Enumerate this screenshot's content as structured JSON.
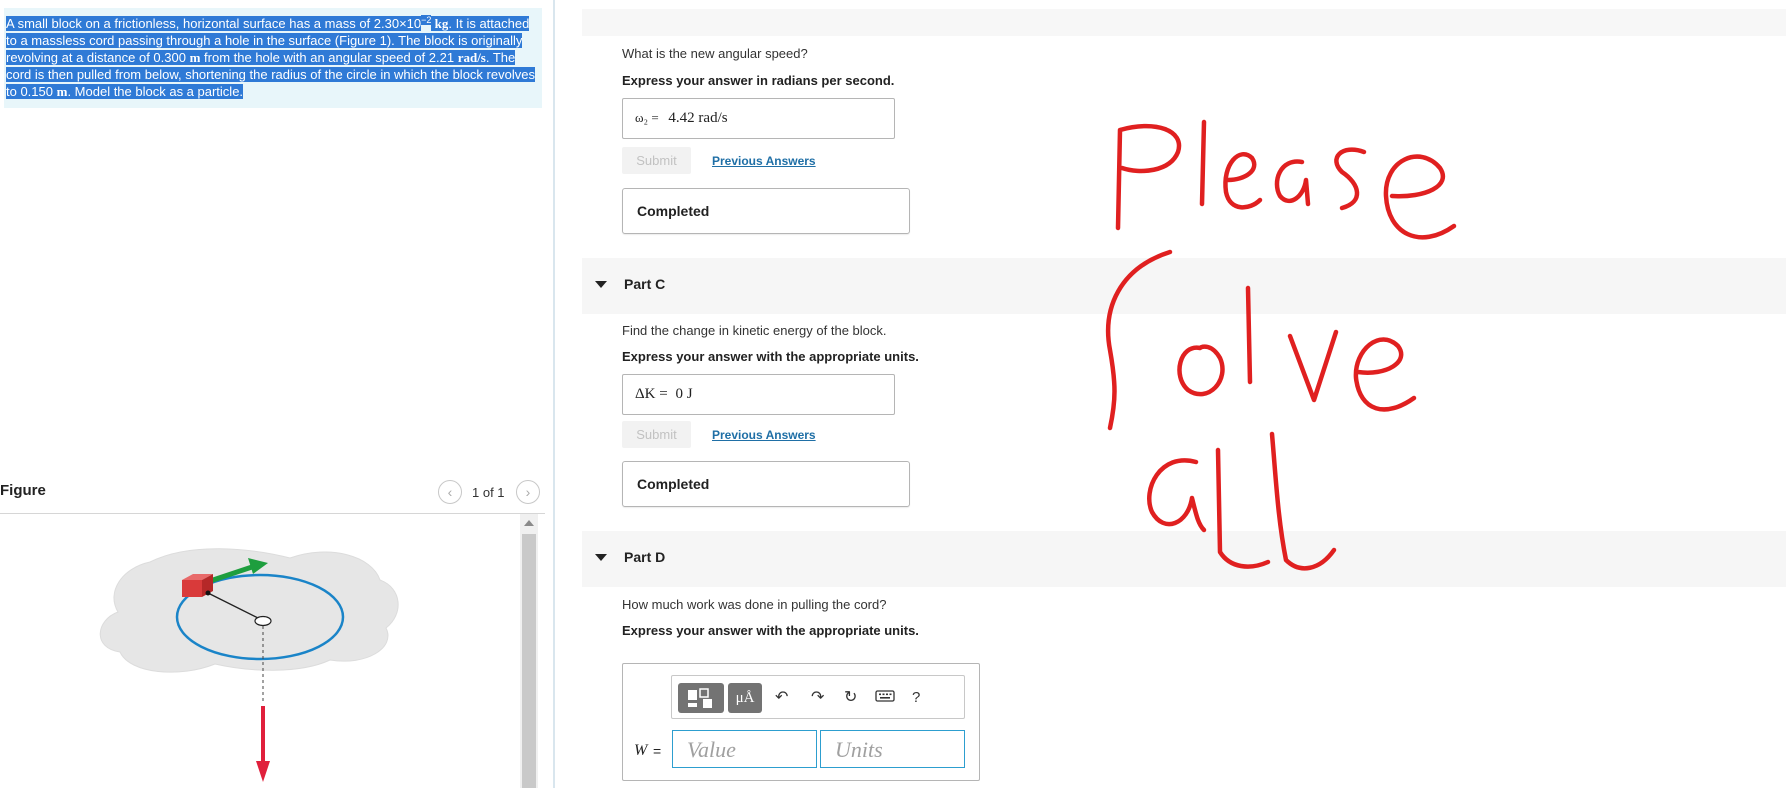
{
  "problem": {
    "segments": [
      {
        "text": "A small block on a frictionless, horizontal surface has a mass of ",
        "style": "plain"
      },
      {
        "text": "2.30×10",
        "style": "plain"
      },
      {
        "text": "−2",
        "style": "sup"
      },
      {
        "text": " kg",
        "style": "math-unit"
      },
      {
        "text": ". It is attached to a massless cord passing through a hole in the surface (Figure 1). The block is originally revolving at a distance of 0.300 ",
        "style": "plain"
      },
      {
        "text": "m",
        "style": "math-unit"
      },
      {
        "text": " from the hole with an angular speed of 2.21 ",
        "style": "plain"
      },
      {
        "text": "rad/s",
        "style": "math-unit"
      },
      {
        "text": ". The cord is then pulled from below, shortening the radius of the circle in which the block revolves to 0.150 ",
        "style": "plain"
      },
      {
        "text": "m",
        "style": "math-unit"
      },
      {
        "text": ". Model the block as a particle.",
        "style": "plain"
      }
    ]
  },
  "figure": {
    "title": "Figure",
    "counter": "1 of 1",
    "prev_icon": "chevron-left-icon",
    "next_icon": "chevron-right-icon",
    "colors": {
      "block": "#d93a3a",
      "velocity_arrow": "#1e9e3e",
      "orbit": "#1a84c8",
      "pull_arrow": "#e0203c",
      "surface": "#e8e8e8"
    }
  },
  "part_b": {
    "question": "What is the new angular speed?",
    "instruction": "Express your answer in radians per second.",
    "answer_label": "ω₂ =",
    "answer_value": "4.42  rad/s",
    "submit_label": "Submit",
    "previous_answers_label": "Previous Answers",
    "status": "Completed"
  },
  "part_c": {
    "title": "Part C",
    "question": "Find the change in kinetic energy of the block.",
    "instruction": "Express your answer with the appropriate units.",
    "answer_label": "ΔK =",
    "answer_value": "0 J",
    "submit_label": "Submit",
    "previous_answers_label": "Previous Answers",
    "status": "Completed"
  },
  "part_d": {
    "title": "Part D",
    "question": "How much work was done in pulling the cord?",
    "instruction": "Express your answer with the appropriate units.",
    "variable": "W",
    "equals": "=",
    "value_placeholder": "Value",
    "units_placeholder": "Units",
    "toolbar": {
      "templates_icon": "templates-icon",
      "units_button": "μÅ",
      "undo_icon": "undo-icon",
      "redo_icon": "redo-icon",
      "reset_icon": "reset-icon",
      "keyboard_icon": "keyboard-icon",
      "help": "?"
    }
  },
  "handwriting": {
    "text": "Please solve all",
    "color": "#e02020"
  }
}
